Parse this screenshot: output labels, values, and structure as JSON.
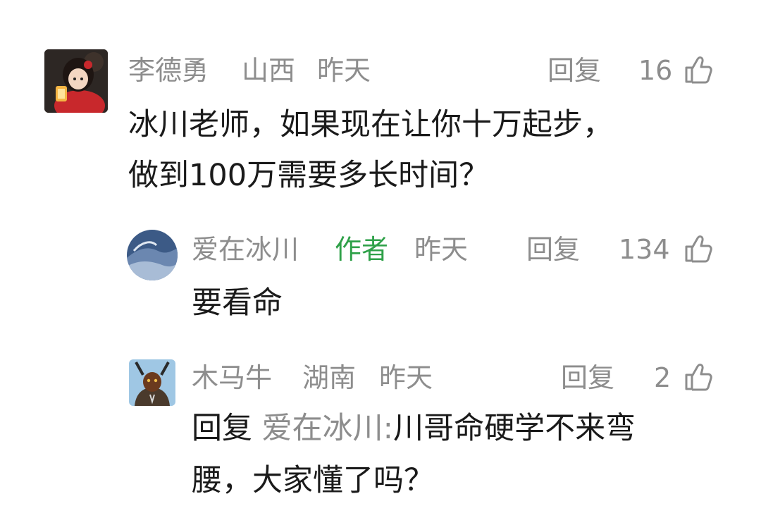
{
  "comments": [
    {
      "name": "李德勇",
      "region": "山西",
      "time": "昨天",
      "reply_label": "回复",
      "likes": "16",
      "text_lines": [
        "冰川老师，如果现在让你十万起步，",
        "做到100万需要多长时间？"
      ]
    },
    {
      "name": "爱在冰川",
      "author_badge": "作者",
      "time": "昨天",
      "reply_label": "回复",
      "likes": "134",
      "text_lines": [
        "要看命"
      ]
    },
    {
      "name": "木马牛",
      "region": "湖南",
      "time": "昨天",
      "reply_label": "回复",
      "likes": "2",
      "reply_prefix": "回复",
      "reply_target": "爱在冰川:",
      "text_line1_rest": "川哥命硬学不来弯",
      "text_line2": "腰，大家懂了吗？"
    }
  ],
  "colors": {
    "meta": "#8d8d8d",
    "author": "#2fa149",
    "text": "#1a1a1a"
  },
  "icons": {
    "like": "thumbs-up-icon"
  }
}
